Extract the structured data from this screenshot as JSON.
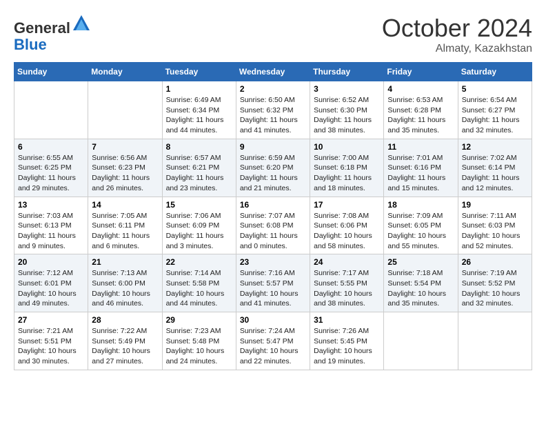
{
  "header": {
    "logo_general": "General",
    "logo_blue": "Blue",
    "month_title": "October 2024",
    "location": "Almaty, Kazakhstan"
  },
  "days_of_week": [
    "Sunday",
    "Monday",
    "Tuesday",
    "Wednesday",
    "Thursday",
    "Friday",
    "Saturday"
  ],
  "weeks": [
    [
      {
        "day": "",
        "sunrise": "",
        "sunset": "",
        "daylight": ""
      },
      {
        "day": "",
        "sunrise": "",
        "sunset": "",
        "daylight": ""
      },
      {
        "day": "1",
        "sunrise": "Sunrise: 6:49 AM",
        "sunset": "Sunset: 6:34 PM",
        "daylight": "Daylight: 11 hours and 44 minutes."
      },
      {
        "day": "2",
        "sunrise": "Sunrise: 6:50 AM",
        "sunset": "Sunset: 6:32 PM",
        "daylight": "Daylight: 11 hours and 41 minutes."
      },
      {
        "day": "3",
        "sunrise": "Sunrise: 6:52 AM",
        "sunset": "Sunset: 6:30 PM",
        "daylight": "Daylight: 11 hours and 38 minutes."
      },
      {
        "day": "4",
        "sunrise": "Sunrise: 6:53 AM",
        "sunset": "Sunset: 6:28 PM",
        "daylight": "Daylight: 11 hours and 35 minutes."
      },
      {
        "day": "5",
        "sunrise": "Sunrise: 6:54 AM",
        "sunset": "Sunset: 6:27 PM",
        "daylight": "Daylight: 11 hours and 32 minutes."
      }
    ],
    [
      {
        "day": "6",
        "sunrise": "Sunrise: 6:55 AM",
        "sunset": "Sunset: 6:25 PM",
        "daylight": "Daylight: 11 hours and 29 minutes."
      },
      {
        "day": "7",
        "sunrise": "Sunrise: 6:56 AM",
        "sunset": "Sunset: 6:23 PM",
        "daylight": "Daylight: 11 hours and 26 minutes."
      },
      {
        "day": "8",
        "sunrise": "Sunrise: 6:57 AM",
        "sunset": "Sunset: 6:21 PM",
        "daylight": "Daylight: 11 hours and 23 minutes."
      },
      {
        "day": "9",
        "sunrise": "Sunrise: 6:59 AM",
        "sunset": "Sunset: 6:20 PM",
        "daylight": "Daylight: 11 hours and 21 minutes."
      },
      {
        "day": "10",
        "sunrise": "Sunrise: 7:00 AM",
        "sunset": "Sunset: 6:18 PM",
        "daylight": "Daylight: 11 hours and 18 minutes."
      },
      {
        "day": "11",
        "sunrise": "Sunrise: 7:01 AM",
        "sunset": "Sunset: 6:16 PM",
        "daylight": "Daylight: 11 hours and 15 minutes."
      },
      {
        "day": "12",
        "sunrise": "Sunrise: 7:02 AM",
        "sunset": "Sunset: 6:14 PM",
        "daylight": "Daylight: 11 hours and 12 minutes."
      }
    ],
    [
      {
        "day": "13",
        "sunrise": "Sunrise: 7:03 AM",
        "sunset": "Sunset: 6:13 PM",
        "daylight": "Daylight: 11 hours and 9 minutes."
      },
      {
        "day": "14",
        "sunrise": "Sunrise: 7:05 AM",
        "sunset": "Sunset: 6:11 PM",
        "daylight": "Daylight: 11 hours and 6 minutes."
      },
      {
        "day": "15",
        "sunrise": "Sunrise: 7:06 AM",
        "sunset": "Sunset: 6:09 PM",
        "daylight": "Daylight: 11 hours and 3 minutes."
      },
      {
        "day": "16",
        "sunrise": "Sunrise: 7:07 AM",
        "sunset": "Sunset: 6:08 PM",
        "daylight": "Daylight: 11 hours and 0 minutes."
      },
      {
        "day": "17",
        "sunrise": "Sunrise: 7:08 AM",
        "sunset": "Sunset: 6:06 PM",
        "daylight": "Daylight: 10 hours and 58 minutes."
      },
      {
        "day": "18",
        "sunrise": "Sunrise: 7:09 AM",
        "sunset": "Sunset: 6:05 PM",
        "daylight": "Daylight: 10 hours and 55 minutes."
      },
      {
        "day": "19",
        "sunrise": "Sunrise: 7:11 AM",
        "sunset": "Sunset: 6:03 PM",
        "daylight": "Daylight: 10 hours and 52 minutes."
      }
    ],
    [
      {
        "day": "20",
        "sunrise": "Sunrise: 7:12 AM",
        "sunset": "Sunset: 6:01 PM",
        "daylight": "Daylight: 10 hours and 49 minutes."
      },
      {
        "day": "21",
        "sunrise": "Sunrise: 7:13 AM",
        "sunset": "Sunset: 6:00 PM",
        "daylight": "Daylight: 10 hours and 46 minutes."
      },
      {
        "day": "22",
        "sunrise": "Sunrise: 7:14 AM",
        "sunset": "Sunset: 5:58 PM",
        "daylight": "Daylight: 10 hours and 44 minutes."
      },
      {
        "day": "23",
        "sunrise": "Sunrise: 7:16 AM",
        "sunset": "Sunset: 5:57 PM",
        "daylight": "Daylight: 10 hours and 41 minutes."
      },
      {
        "day": "24",
        "sunrise": "Sunrise: 7:17 AM",
        "sunset": "Sunset: 5:55 PM",
        "daylight": "Daylight: 10 hours and 38 minutes."
      },
      {
        "day": "25",
        "sunrise": "Sunrise: 7:18 AM",
        "sunset": "Sunset: 5:54 PM",
        "daylight": "Daylight: 10 hours and 35 minutes."
      },
      {
        "day": "26",
        "sunrise": "Sunrise: 7:19 AM",
        "sunset": "Sunset: 5:52 PM",
        "daylight": "Daylight: 10 hours and 32 minutes."
      }
    ],
    [
      {
        "day": "27",
        "sunrise": "Sunrise: 7:21 AM",
        "sunset": "Sunset: 5:51 PM",
        "daylight": "Daylight: 10 hours and 30 minutes."
      },
      {
        "day": "28",
        "sunrise": "Sunrise: 7:22 AM",
        "sunset": "Sunset: 5:49 PM",
        "daylight": "Daylight: 10 hours and 27 minutes."
      },
      {
        "day": "29",
        "sunrise": "Sunrise: 7:23 AM",
        "sunset": "Sunset: 5:48 PM",
        "daylight": "Daylight: 10 hours and 24 minutes."
      },
      {
        "day": "30",
        "sunrise": "Sunrise: 7:24 AM",
        "sunset": "Sunset: 5:47 PM",
        "daylight": "Daylight: 10 hours and 22 minutes."
      },
      {
        "day": "31",
        "sunrise": "Sunrise: 7:26 AM",
        "sunset": "Sunset: 5:45 PM",
        "daylight": "Daylight: 10 hours and 19 minutes."
      },
      {
        "day": "",
        "sunrise": "",
        "sunset": "",
        "daylight": ""
      },
      {
        "day": "",
        "sunrise": "",
        "sunset": "",
        "daylight": ""
      }
    ]
  ]
}
